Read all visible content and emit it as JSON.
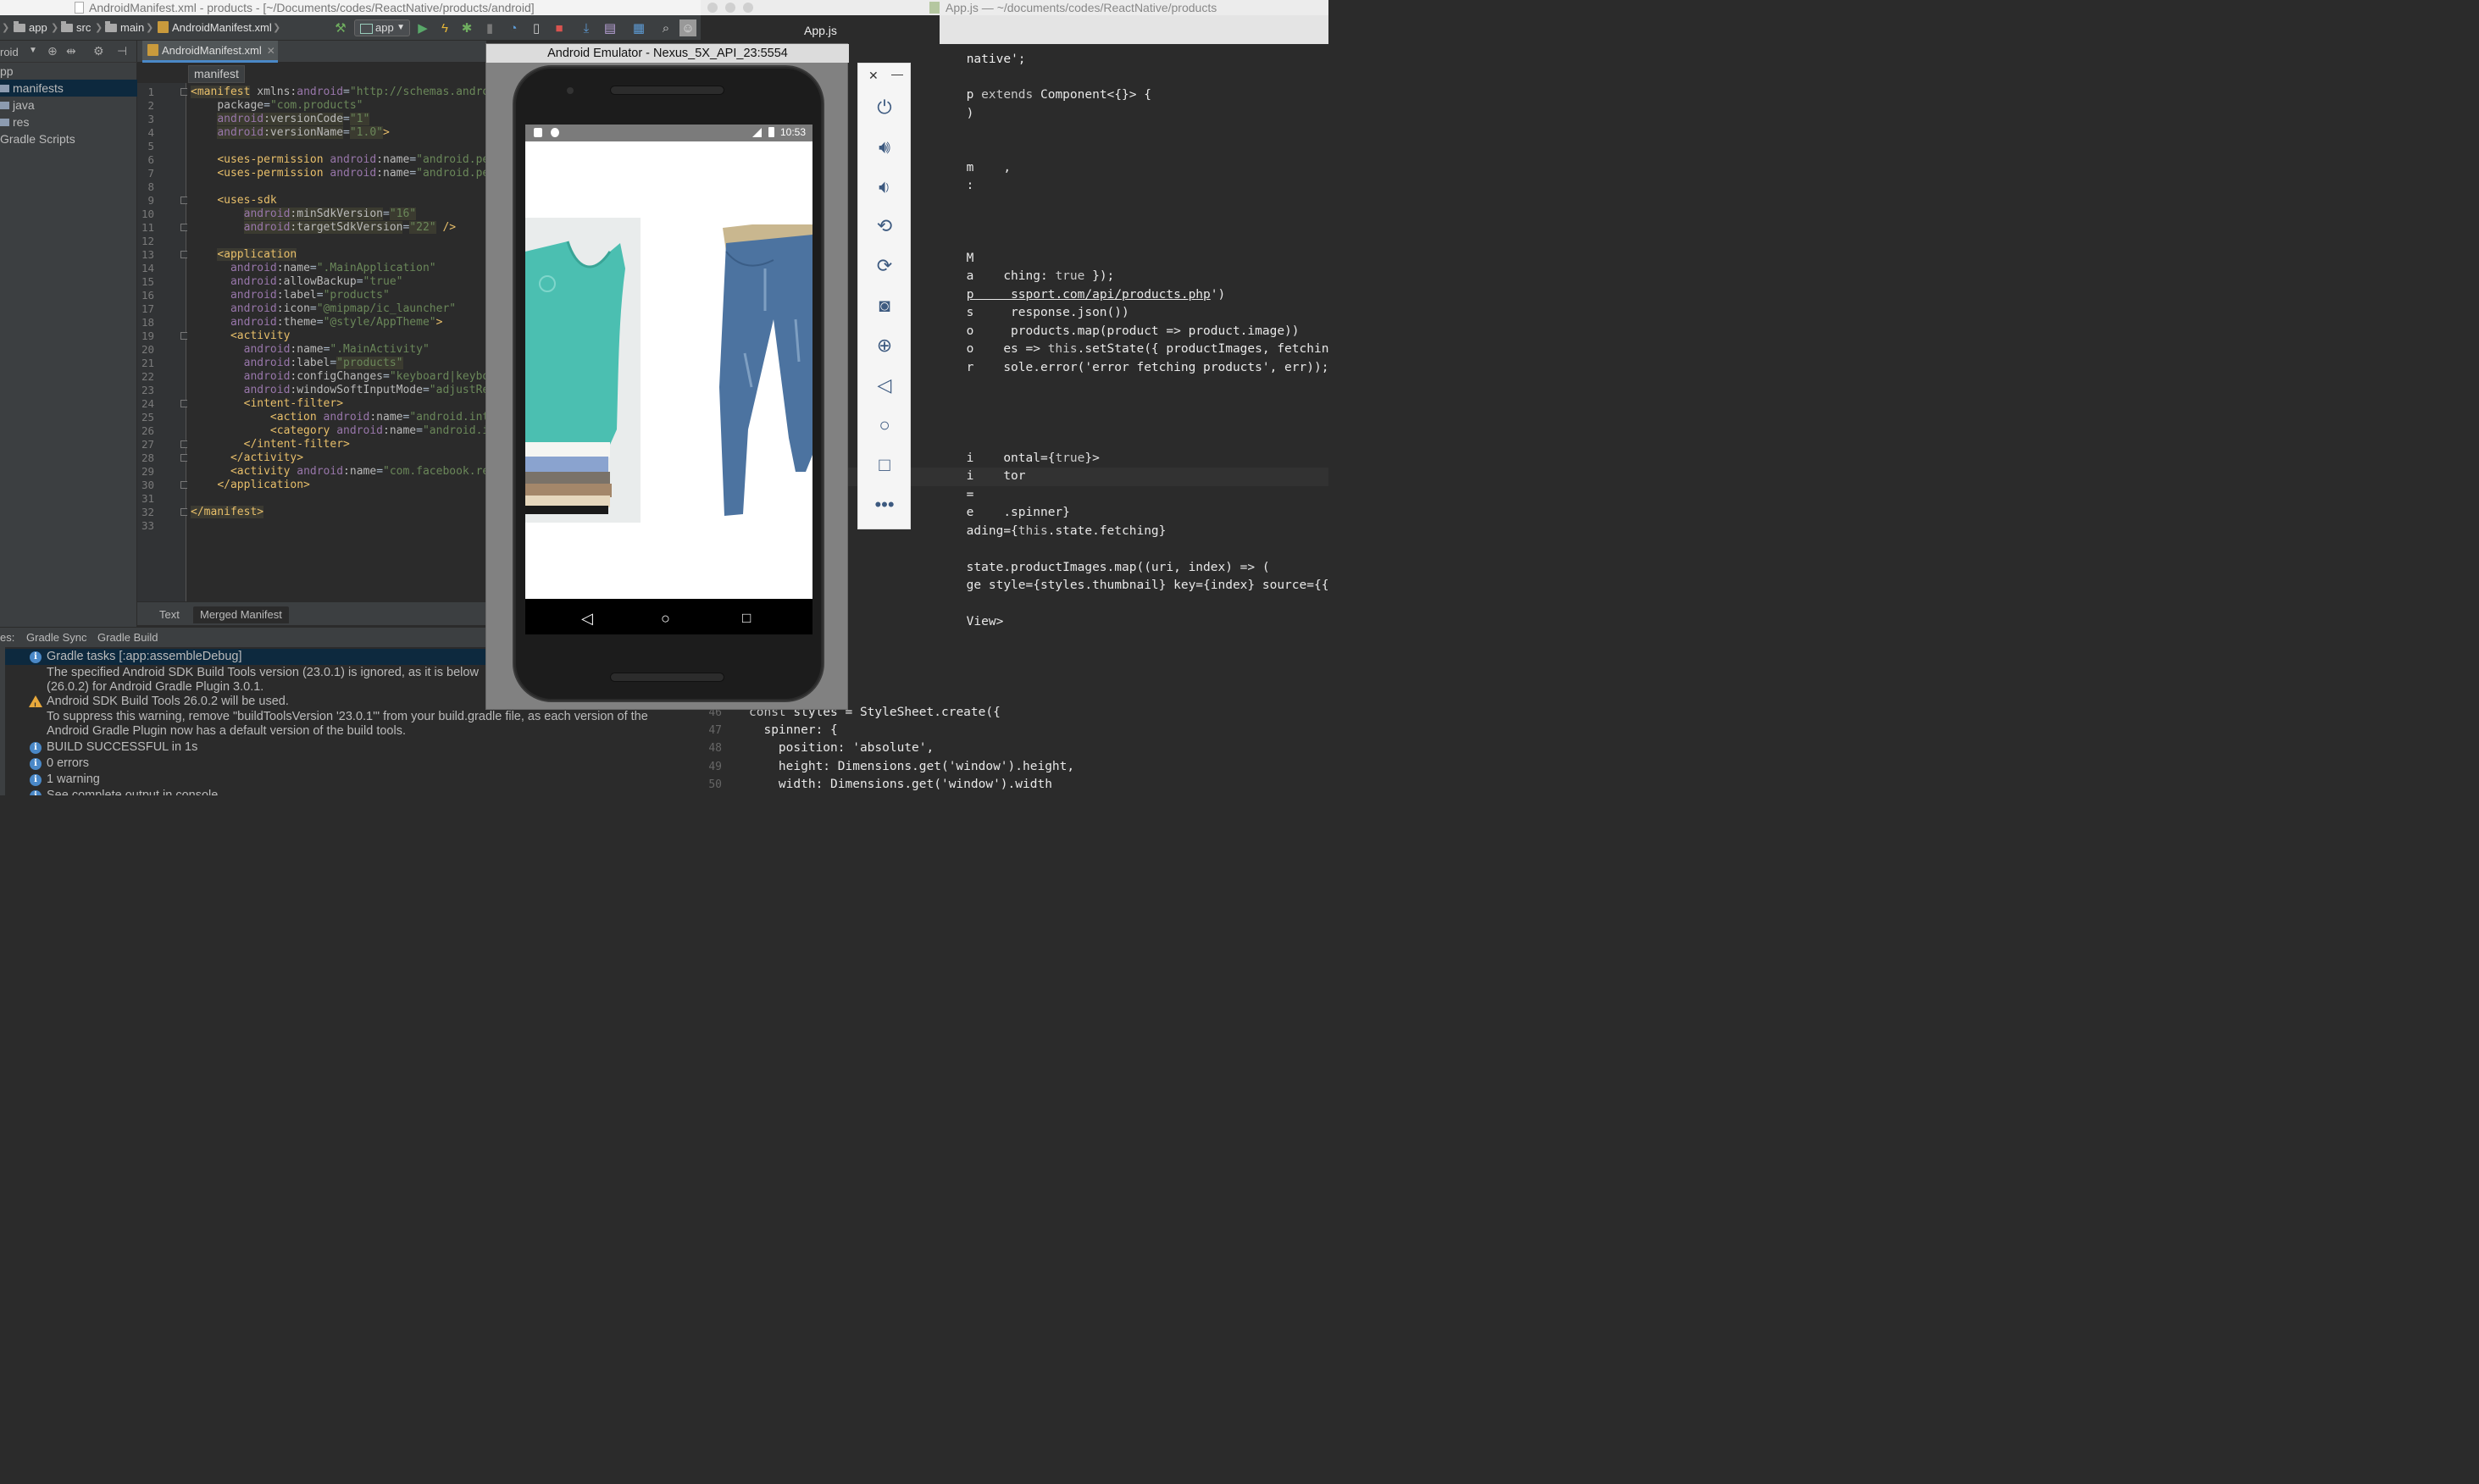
{
  "studio": {
    "window_title": "AndroidManifest.xml - products - [~/Documents/codes/ReactNative/products/android]",
    "breadcrumbs": [
      "app",
      "src",
      "main",
      "AndroidManifest.xml"
    ],
    "run_config": "app",
    "project_panel_label": "roid",
    "tree": [
      {
        "label": "pp",
        "indent": 0
      },
      {
        "label": "manifests",
        "indent": 1,
        "selected": true
      },
      {
        "label": "java",
        "indent": 1
      },
      {
        "label": "res",
        "indent": 1
      },
      {
        "label": "Gradle Scripts",
        "indent": 0
      }
    ],
    "editor_tab": "AndroidManifest.xml",
    "element_breadcrumb": "manifest",
    "bottom_tabs": [
      "Text",
      "Merged Manifest"
    ],
    "messages_tabs": [
      "es:",
      "Gradle Sync",
      "Gradle Build"
    ],
    "messages": [
      {
        "icon": "info",
        "text": "Gradle tasks [:app:assembleDebug]",
        "selected": true
      },
      {
        "icon": "none",
        "text": "The specified Android SDK Build Tools version (23.0.1) is ignored, as it is below"
      },
      {
        "icon": "none",
        "text": "(26.0.2) for Android Gradle Plugin 3.0.1."
      },
      {
        "icon": "warning",
        "text": "Android SDK Build Tools 26.0.2 will be used."
      },
      {
        "icon": "none",
        "text": "To suppress this warning, remove \"buildToolsVersion '23.0.1'\" from your build.gradle file, as each version of the"
      },
      {
        "icon": "none",
        "text": "Android Gradle Plugin now has a default version of the build tools."
      },
      {
        "icon": "info",
        "text": "BUILD SUCCESSFUL in 1s"
      },
      {
        "icon": "info",
        "text": "0 errors"
      },
      {
        "icon": "info",
        "text": "1 warning"
      },
      {
        "icon": "info",
        "text": "See complete output in console"
      }
    ]
  },
  "manifest_lines": [
    "1",
    "2",
    "3",
    "4",
    "5",
    "6",
    "7",
    "8",
    "9",
    "10",
    "11",
    "12",
    "13",
    "14",
    "15",
    "16",
    "17",
    "18",
    "19",
    "20",
    "21",
    "22",
    "23",
    "24",
    "25",
    "26",
    "27",
    "28",
    "29",
    "30",
    "31",
    "32",
    "33"
  ],
  "js": {
    "window_title": "App.js — ~/documents/codes/ReactNative/products",
    "tab": "App.js",
    "line_numbers": [
      "46",
      "47",
      "48",
      "49",
      "50"
    ]
  },
  "emulator": {
    "title": "Android Emulator - Nexus_5X_API_23:5554",
    "clock": "10:53",
    "toolbar": [
      "close-icon",
      "minimize-icon",
      "power-icon",
      "volume-up-icon",
      "volume-down-icon",
      "rotate-left-icon",
      "rotate-right-icon",
      "camera-icon",
      "zoom-icon",
      "back-icon",
      "home-icon",
      "overview-icon",
      "more-icon"
    ],
    "products": [
      "teal tank top stack",
      "blue jeans"
    ]
  }
}
